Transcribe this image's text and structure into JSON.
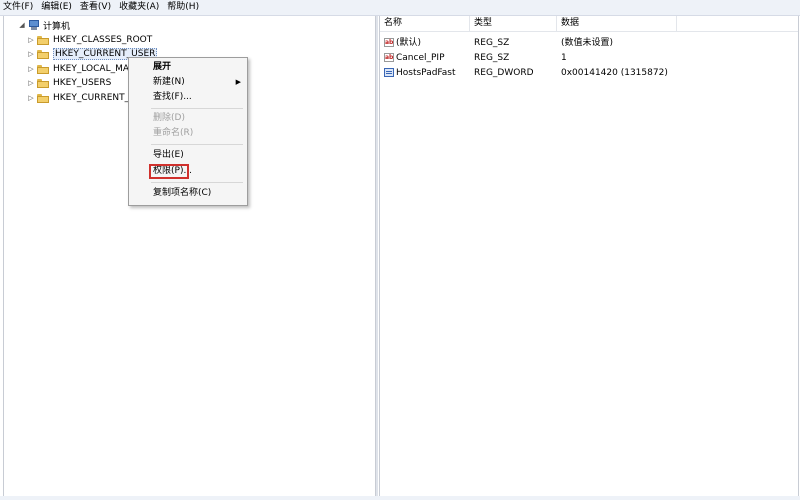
{
  "menubar": {
    "items": [
      "文件(F)",
      "编辑(E)",
      "查看(V)",
      "收藏夹(A)",
      "帮助(H)"
    ]
  },
  "tree": {
    "root": "计算机",
    "keys": [
      "HKEY_CLASSES_ROOT",
      "HKEY_CURRENT_USER",
      "HKEY_LOCAL_MAC",
      "HKEY_USERS",
      "HKEY_CURRENT_C"
    ],
    "selected_index": 1
  },
  "context_menu": {
    "items": [
      {
        "label": "展开",
        "bold": true,
        "disabled": false
      },
      {
        "label": "新建(N)",
        "bold": false,
        "disabled": false,
        "submenu": true
      },
      {
        "label": "查找(F)...",
        "bold": false,
        "disabled": false
      },
      {
        "label": "删除(D)",
        "bold": false,
        "disabled": true
      },
      {
        "label": "重命名(R)",
        "bold": false,
        "disabled": true
      },
      {
        "label": "导出(E)",
        "bold": false,
        "disabled": false
      },
      {
        "label": "权限(P)...",
        "bold": false,
        "disabled": false,
        "highlighted": true
      },
      {
        "label": "复制项名称(C)",
        "bold": false,
        "disabled": false
      }
    ],
    "highlight_color": "#d0312d"
  },
  "values_pane": {
    "columns": [
      "名称",
      "类型",
      "数据"
    ],
    "rows": [
      {
        "name": "(默认)",
        "type": "REG_SZ",
        "data": "(数值未设置)",
        "icon": "string-value-icon"
      },
      {
        "name": "Cancel_PIP",
        "type": "REG_SZ",
        "data": "1",
        "icon": "string-value-icon"
      },
      {
        "name": "HostsPadFast",
        "type": "REG_DWORD",
        "data": "0x00141420 (1315872)",
        "icon": "dword-value-icon"
      }
    ]
  },
  "icons": {
    "string": "ab",
    "expand": "▷",
    "collapse": "◢",
    "submenu": "▶"
  }
}
